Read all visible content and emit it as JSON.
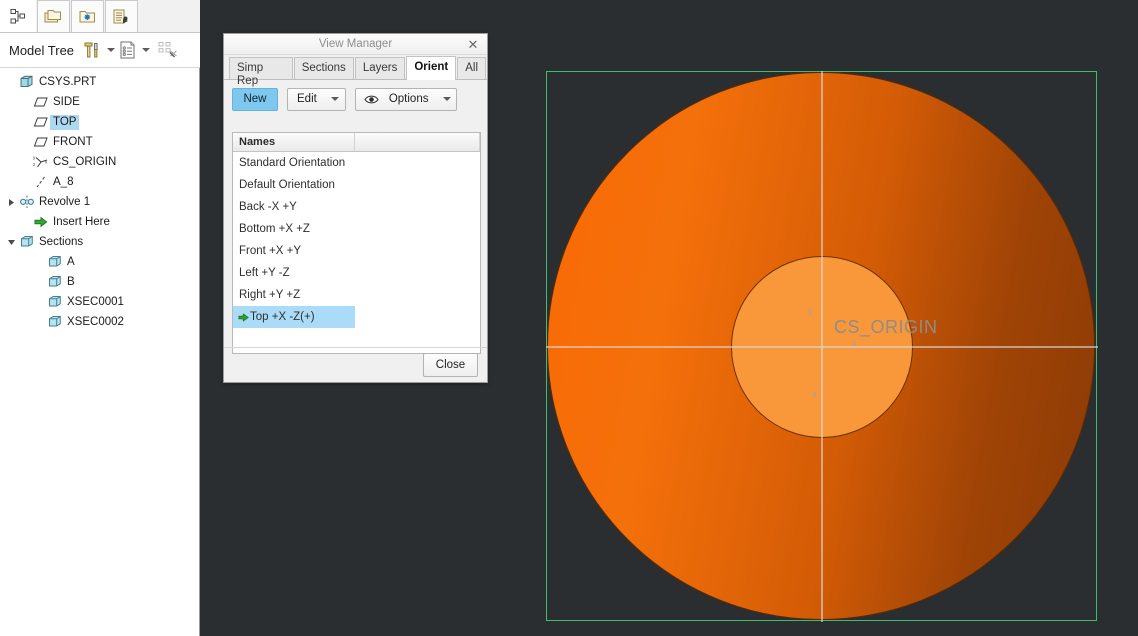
{
  "left_panel": {
    "tabs": [
      {
        "icon": "model-tree-tab-icon",
        "name": "tab-model-tree"
      },
      {
        "icon": "folders-tab-icon",
        "name": "tab-folders"
      },
      {
        "icon": "favorites-folder-tab-icon",
        "name": "tab-favorites"
      },
      {
        "icon": "detail-tree-tab-icon",
        "name": "tab-detail-tree"
      }
    ],
    "toolbar": {
      "title": "Model Tree",
      "settings_icon": "tools-icon",
      "display_icon": "tree-columns-icon",
      "filter_icon": "tree-filter-off-icon"
    },
    "tree": [
      {
        "label": "CSYS.PRT",
        "indent": 0,
        "icon": "part-icon",
        "expander": "none",
        "highlighted": false
      },
      {
        "label": "SIDE",
        "indent": 1,
        "icon": "datum-plane-icon",
        "expander": "none",
        "highlighted": false
      },
      {
        "label": "TOP",
        "indent": 1,
        "icon": "datum-plane-icon",
        "expander": "none",
        "highlighted": true
      },
      {
        "label": "FRONT",
        "indent": 1,
        "icon": "datum-plane-icon",
        "expander": "none",
        "highlighted": false
      },
      {
        "label": "CS_ORIGIN",
        "indent": 1,
        "icon": "coordinate-system-icon",
        "expander": "none",
        "highlighted": false
      },
      {
        "label": "A_8",
        "indent": 1,
        "icon": "datum-axis-icon",
        "expander": "none",
        "highlighted": false
      },
      {
        "label": "Revolve 1",
        "indent": 0,
        "icon": "revolve-feature-icon",
        "expander": "collapsed",
        "highlighted": false
      },
      {
        "label": "Insert Here",
        "indent": 1,
        "icon": "insert-here-arrow-icon",
        "expander": "none",
        "highlighted": false
      },
      {
        "label": "Sections",
        "indent": 0,
        "icon": "sections-folder-icon",
        "expander": "expanded",
        "highlighted": false
      },
      {
        "label": "A",
        "indent": 2,
        "icon": "section-icon",
        "expander": "none",
        "highlighted": false
      },
      {
        "label": "B",
        "indent": 2,
        "icon": "section-icon",
        "expander": "none",
        "highlighted": false
      },
      {
        "label": "XSEC0001",
        "indent": 2,
        "icon": "section-icon",
        "expander": "none",
        "highlighted": false
      },
      {
        "label": "XSEC0002",
        "indent": 2,
        "icon": "section-icon",
        "expander": "none",
        "highlighted": false
      }
    ]
  },
  "dialog": {
    "title": "View Manager",
    "close_icon": "close-icon",
    "tabs": [
      {
        "label": "Simp Rep",
        "active": false
      },
      {
        "label": "Sections",
        "active": false
      },
      {
        "label": "Layers",
        "active": false
      },
      {
        "label": "Orient",
        "active": true
      },
      {
        "label": "All",
        "active": false
      }
    ],
    "actions": {
      "new_label": "New",
      "edit_label": "Edit",
      "options_label": "Options",
      "options_icon": "eye-icon",
      "caret_icon": "chevron-down-icon"
    },
    "list_header": "Names",
    "orientations": [
      {
        "label": "Standard Orientation",
        "selected": false,
        "has_arrow": false
      },
      {
        "label": "Default Orientation",
        "selected": false,
        "has_arrow": false
      },
      {
        "label": "Back -X +Y",
        "selected": false,
        "has_arrow": false
      },
      {
        "label": "Bottom +X +Z",
        "selected": false,
        "has_arrow": false
      },
      {
        "label": "Front +X +Y",
        "selected": false,
        "has_arrow": false
      },
      {
        "label": "Left +Y -Z",
        "selected": false,
        "has_arrow": false
      },
      {
        "label": "Right +Y +Z",
        "selected": false,
        "has_arrow": false
      },
      {
        "label": "Top +X -Z(+)",
        "selected": true,
        "has_arrow": true
      }
    ],
    "close_label": "Close"
  },
  "viewport": {
    "csys_label": "CS_ORIGIN",
    "axis_tags": {
      "y": "y",
      "x": "x",
      "z": "z"
    },
    "colors": {
      "background": "#2b2e30",
      "frame": "#3dbd6e",
      "outer_light": "#fa6a06",
      "outer_dark": "#8a3a06",
      "inner": "#f8983a",
      "axis_line": "#d7d7d7"
    }
  }
}
